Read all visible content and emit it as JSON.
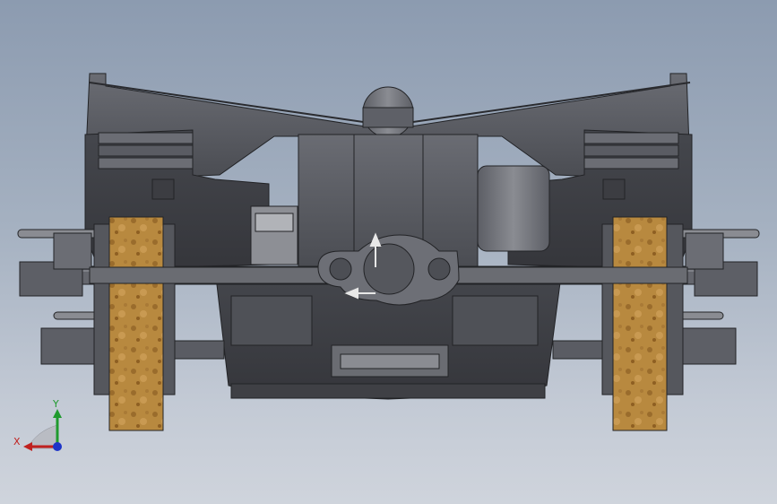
{
  "viewport": {
    "title": "",
    "background_top": "#8c9bb0",
    "background_bottom": "#cfd4dc"
  },
  "model": {
    "body_color": "#55575d",
    "edge_color": "#222326",
    "wheel_color": "#b8893f",
    "view": "front"
  },
  "triad": {
    "x_label": "X",
    "y_label": "Y",
    "x_color": "#c0211f",
    "y_color": "#1f9a2e",
    "z_color": "#1d34c8"
  }
}
